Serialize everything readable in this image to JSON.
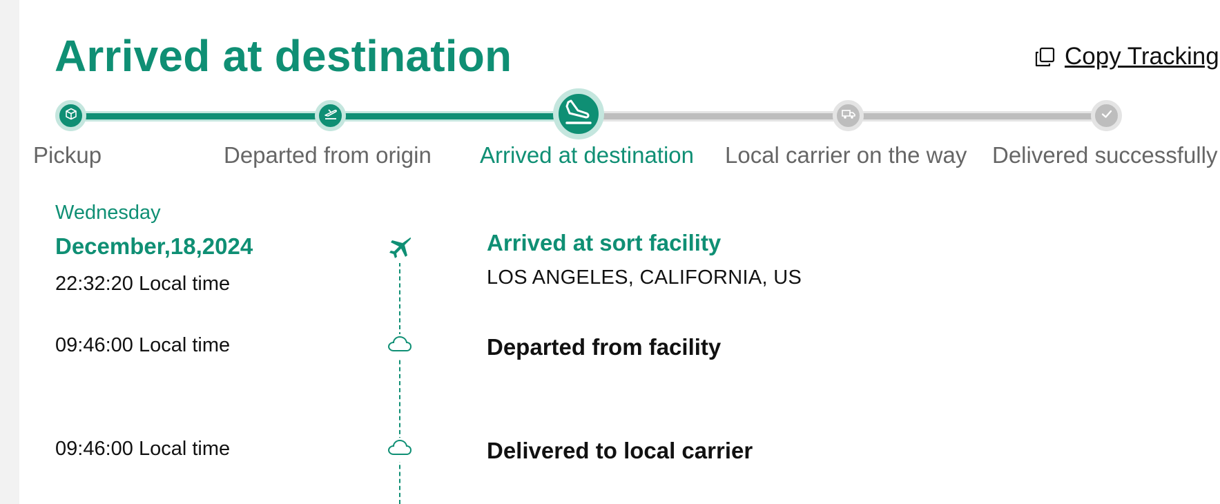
{
  "header": {
    "status_title": "Arrived at destination",
    "copy_label": "Copy Tracking"
  },
  "progress": {
    "current_step_index": 2,
    "steps": [
      {
        "label": "Pickup",
        "icon": "package-icon",
        "state": "done"
      },
      {
        "label": "Departed from origin",
        "icon": "plane-departure-icon",
        "state": "done"
      },
      {
        "label": "Arrived at destination",
        "icon": "plane-landing-icon",
        "state": "current"
      },
      {
        "label": "Local carrier on the way",
        "icon": "truck-icon",
        "state": "pending"
      },
      {
        "label": "Delivered successfully",
        "icon": "check-icon",
        "state": "pending"
      }
    ]
  },
  "timeline": {
    "day_name": "Wednesday",
    "date": "December,18,2024",
    "events": [
      {
        "time": "22:32:20 Local time",
        "title": "Arrived at sort facility",
        "location": "LOS ANGELES, CALIFORNIA, US",
        "icon": "airplane-icon",
        "highlighted": true
      },
      {
        "time": "09:46:00 Local time",
        "title": "Departed from facility",
        "icon": "cloud-icon",
        "highlighted": false
      },
      {
        "time": "09:46:00 Local time",
        "title": "Delivered to local carrier",
        "icon": "cloud-icon",
        "highlighted": false
      }
    ]
  },
  "colors": {
    "accent": "#0f8f74",
    "accent_light": "#c4e6de",
    "pending": "#bdbdbd",
    "pending_light": "#e4e4e4",
    "label_gray": "#666666"
  }
}
